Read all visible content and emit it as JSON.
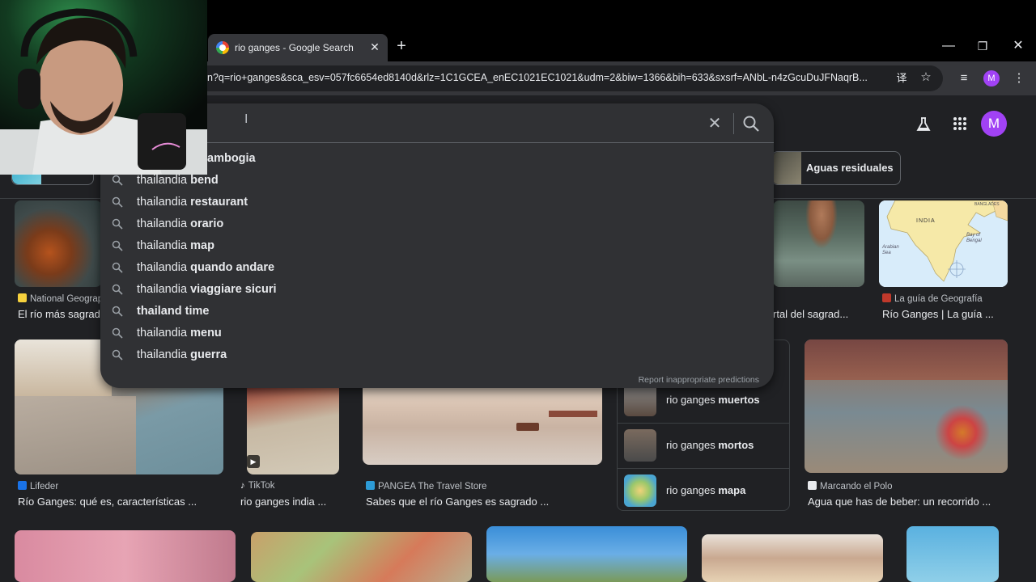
{
  "browser": {
    "tab_title": "rio ganges - Google Search",
    "url": "n?q=rio+ganges&sca_esv=057fc6654ed8140d&rlz=1C1GCEA_enEC1021EC1021&udm=2&biw=1366&bih=633&sxsrf=ANbL-n4zGcuDuJFNaqrB...",
    "profile_initial": "M"
  },
  "search": {
    "input_value": "",
    "suggestions": [
      {
        "prefix": "",
        "bold": "ambogia"
      },
      {
        "prefix": "thailandia",
        "bold": "bend"
      },
      {
        "prefix": "thailandia",
        "bold": "restaurant"
      },
      {
        "prefix": "thailandia",
        "bold": "orario"
      },
      {
        "prefix": "thailandia",
        "bold": "map"
      },
      {
        "prefix": "thailandia",
        "bold": "quando andare"
      },
      {
        "prefix": "thailandia",
        "bold": "viaggiare sicuri"
      },
      {
        "prefix": "",
        "bold": "thailand time"
      },
      {
        "prefix": "thailandia",
        "bold": "menu"
      },
      {
        "prefix": "thailandia",
        "bold": "guerra"
      }
    ],
    "report_link": "Report inappropriate predictions"
  },
  "header": {
    "avatar_initial": "M"
  },
  "chips": {
    "aguas": "Aguas residuales"
  },
  "results": {
    "r1": {
      "source": "National Geograp",
      "title": "El río más sagrad"
    },
    "r2": {
      "source": "",
      "title": "rtal del sagrad..."
    },
    "r3": {
      "source": "La guía de Geografía",
      "title": "Río Ganges | La guía ..."
    },
    "r4": {
      "source": "Lifeder",
      "title": "Río Ganges: qué es, características ..."
    },
    "r5": {
      "source": "TikTok",
      "title": "rio ganges india ..."
    },
    "r6": {
      "source": "PANGEA The Travel Store",
      "title": "Sabes que el río Ganges es sagrado ..."
    },
    "r7": {
      "source": "Marcando el Polo",
      "title": "Agua que has de beber: un recorrido ..."
    }
  },
  "related": [
    {
      "prefix": "rio ganges",
      "bold": "muertos"
    },
    {
      "prefix": "rio ganges",
      "bold": "mortos"
    },
    {
      "prefix": "rio ganges",
      "bold": "mapa"
    }
  ],
  "map_labels": {
    "india": "INDIA",
    "bay": "Bay of Bengal",
    "sea": "Arabian Sea",
    "bangladesh": "BANGLADES"
  },
  "colors": {
    "page_bg": "#202124",
    "panel_bg": "#303134",
    "avatar": "#a142f4"
  }
}
